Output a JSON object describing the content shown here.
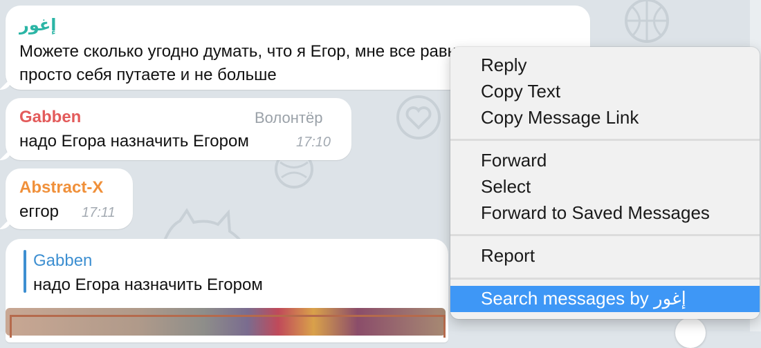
{
  "messages": [
    {
      "sender": "إغور",
      "sender_color": "#2bb5a5",
      "lines": [
        "Можете сколько угодно думать, что я Егор,  мне все равно, вы",
        "просто себя путаете и не больше"
      ]
    },
    {
      "sender": "Gabben",
      "sender_color": "#e35b5b",
      "role": "Волонтёр",
      "text": "надо Егора назначить Егором",
      "time": "17:10"
    },
    {
      "sender": "Abstract-X",
      "sender_color": "#f0903a",
      "text": "еггор",
      "time": "17:11"
    },
    {
      "reply_to_sender": "Gabben",
      "reply_sender_color": "#3d8fd1",
      "reply_text": "надо Егора назначить Егором"
    }
  ],
  "context_menu": {
    "items": [
      "Reply",
      "Copy Text",
      "Copy Message Link",
      "Forward",
      "Select",
      "Forward to Saved Messages",
      "Report",
      "Search messages by إغور"
    ],
    "highlight_color": "#3e97f6"
  }
}
